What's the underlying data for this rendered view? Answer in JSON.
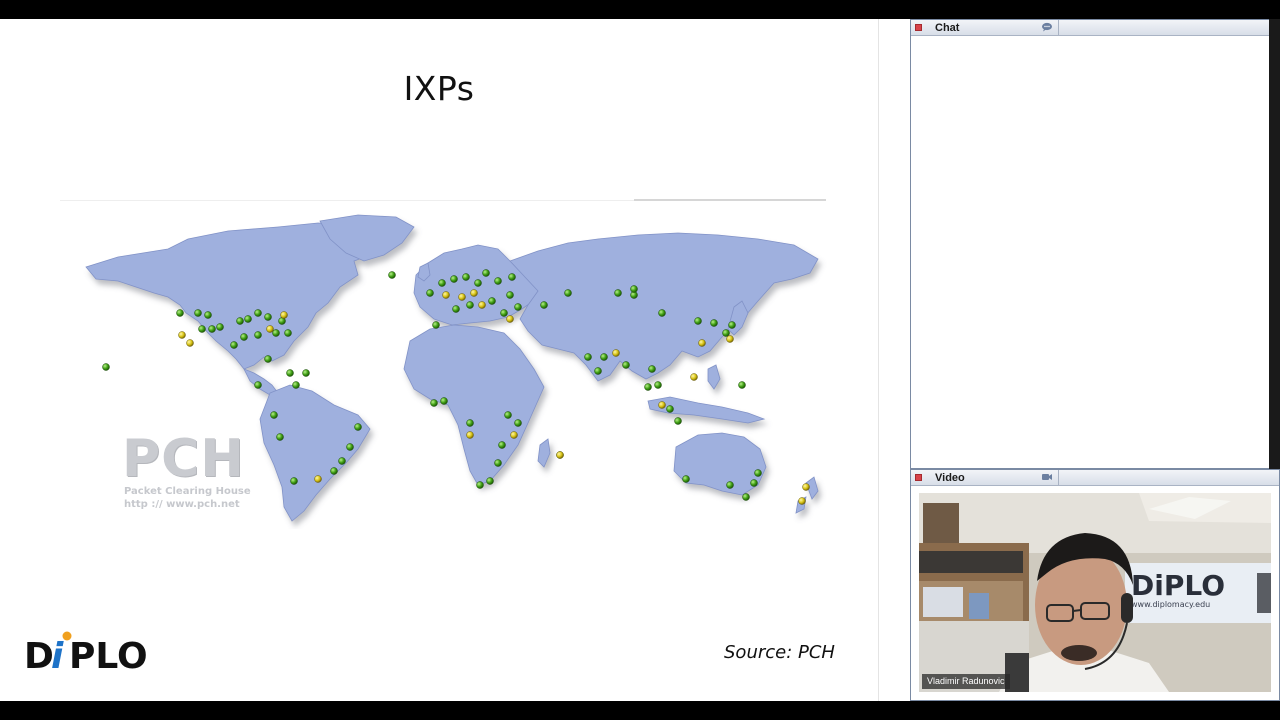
{
  "slide": {
    "title": "IXPs",
    "source": "Source: PCH",
    "watermark": {
      "big": "PCH",
      "line1": "Packet Clearing House",
      "line2": "http :// www.pch.net"
    },
    "logo_text": "DiPLO"
  },
  "chat_panel": {
    "title": "Chat",
    "icon": "chat-bubble-icon",
    "status_color": "#d9434a"
  },
  "video_panel": {
    "title": "Video",
    "icon": "camera-icon",
    "presenter_name": "Vladimir Radunovic",
    "background_sign": {
      "logo": "DiPLO",
      "url": "www.diplomacy.edu"
    }
  },
  "colors": {
    "ocean": "#ffffff",
    "land": "#9fb0de",
    "ixp_green": "#4caf1a",
    "ixp_yellow": "#e4d21b",
    "panel_border": "#7a8aa3"
  }
}
